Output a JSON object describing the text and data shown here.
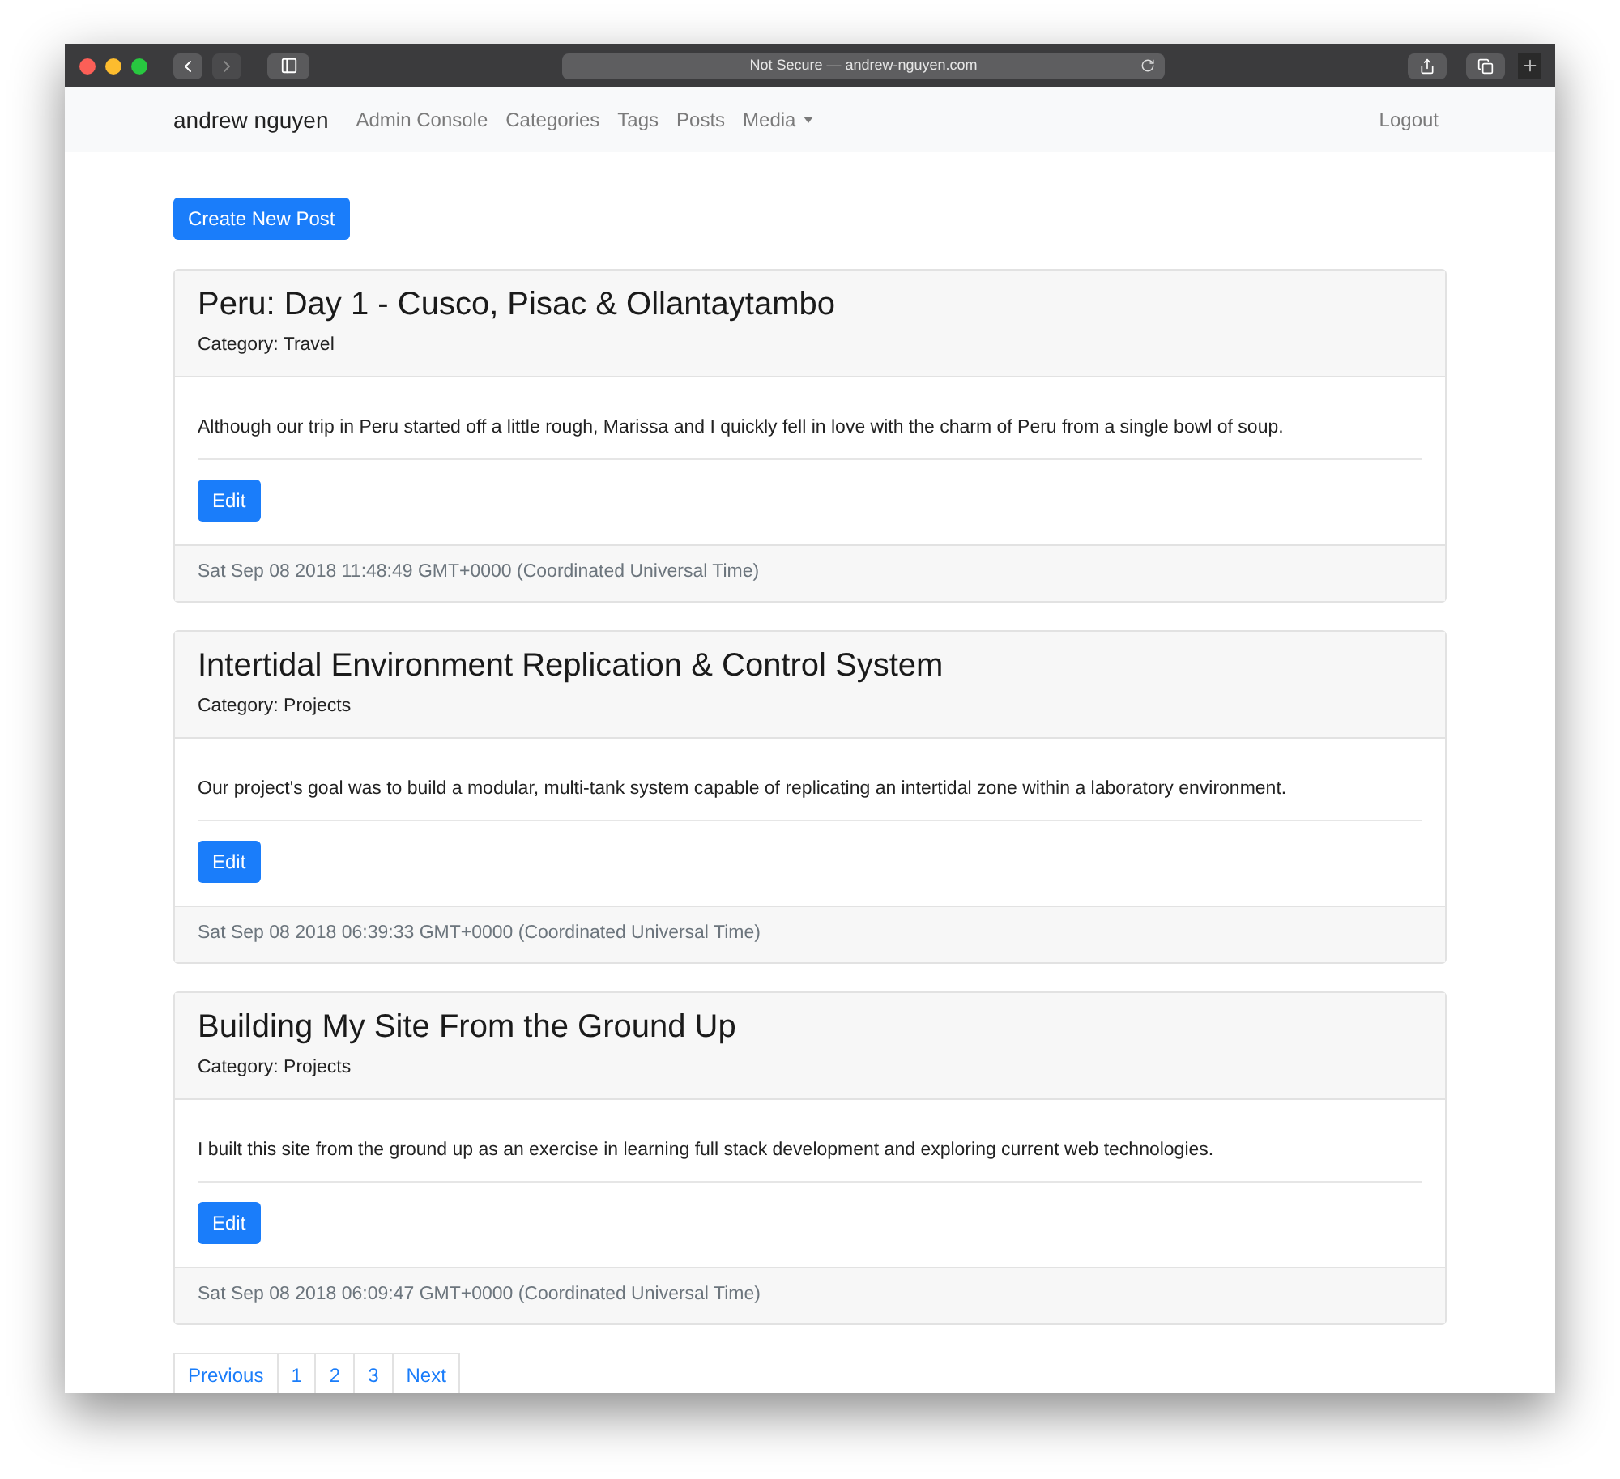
{
  "browser": {
    "address": "Not Secure — andrew-nguyen.com"
  },
  "navbar": {
    "brand": "andrew nguyen",
    "links": [
      {
        "label": "Admin Console",
        "kind": "link"
      },
      {
        "label": "Categories",
        "kind": "link"
      },
      {
        "label": "Tags",
        "kind": "link"
      },
      {
        "label": "Posts",
        "kind": "link"
      },
      {
        "label": "Media",
        "kind": "dropdown"
      }
    ],
    "logout": "Logout"
  },
  "create_button": "Create New Post",
  "posts": [
    {
      "title": "Peru: Day 1 - Cusco, Pisac & Ollantaytambo",
      "category": "Category: Travel",
      "summary": "Although our trip in Peru started off a little rough, Marissa and I quickly fell in love with the charm of Peru from a single bowl of soup.",
      "edit": "Edit",
      "date": "Sat Sep 08 2018 11:48:49 GMT+0000 (Coordinated Universal Time)"
    },
    {
      "title": "Intertidal Environment Replication & Control System",
      "category": "Category: Projects",
      "summary": "Our project's goal was to build a modular, multi-tank system capable of replicating an intertidal zone within a laboratory environment.",
      "edit": "Edit",
      "date": "Sat Sep 08 2018 06:39:33 GMT+0000 (Coordinated Universal Time)"
    },
    {
      "title": "Building My Site From the Ground Up",
      "category": "Category: Projects",
      "summary": "I built this site from the ground up as an exercise in learning full stack development and exploring current web technologies.",
      "edit": "Edit",
      "date": "Sat Sep 08 2018 06:09:47 GMT+0000 (Coordinated Universal Time)"
    }
  ],
  "pagination": [
    "Previous",
    "1",
    "2",
    "3",
    "Next"
  ]
}
